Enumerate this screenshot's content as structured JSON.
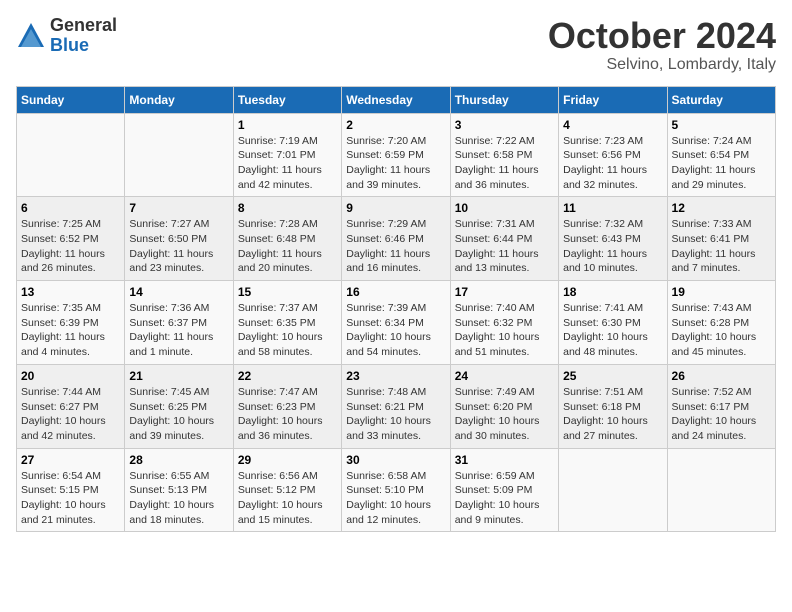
{
  "header": {
    "logo_general": "General",
    "logo_blue": "Blue",
    "month_title": "October 2024",
    "location": "Selvino, Lombardy, Italy"
  },
  "weekdays": [
    "Sunday",
    "Monday",
    "Tuesday",
    "Wednesday",
    "Thursday",
    "Friday",
    "Saturday"
  ],
  "weeks": [
    [
      {
        "day": "",
        "info": ""
      },
      {
        "day": "",
        "info": ""
      },
      {
        "day": "1",
        "info": "Sunrise: 7:19 AM\nSunset: 7:01 PM\nDaylight: 11 hours and 42 minutes."
      },
      {
        "day": "2",
        "info": "Sunrise: 7:20 AM\nSunset: 6:59 PM\nDaylight: 11 hours and 39 minutes."
      },
      {
        "day": "3",
        "info": "Sunrise: 7:22 AM\nSunset: 6:58 PM\nDaylight: 11 hours and 36 minutes."
      },
      {
        "day": "4",
        "info": "Sunrise: 7:23 AM\nSunset: 6:56 PM\nDaylight: 11 hours and 32 minutes."
      },
      {
        "day": "5",
        "info": "Sunrise: 7:24 AM\nSunset: 6:54 PM\nDaylight: 11 hours and 29 minutes."
      }
    ],
    [
      {
        "day": "6",
        "info": "Sunrise: 7:25 AM\nSunset: 6:52 PM\nDaylight: 11 hours and 26 minutes."
      },
      {
        "day": "7",
        "info": "Sunrise: 7:27 AM\nSunset: 6:50 PM\nDaylight: 11 hours and 23 minutes."
      },
      {
        "day": "8",
        "info": "Sunrise: 7:28 AM\nSunset: 6:48 PM\nDaylight: 11 hours and 20 minutes."
      },
      {
        "day": "9",
        "info": "Sunrise: 7:29 AM\nSunset: 6:46 PM\nDaylight: 11 hours and 16 minutes."
      },
      {
        "day": "10",
        "info": "Sunrise: 7:31 AM\nSunset: 6:44 PM\nDaylight: 11 hours and 13 minutes."
      },
      {
        "day": "11",
        "info": "Sunrise: 7:32 AM\nSunset: 6:43 PM\nDaylight: 11 hours and 10 minutes."
      },
      {
        "day": "12",
        "info": "Sunrise: 7:33 AM\nSunset: 6:41 PM\nDaylight: 11 hours and 7 minutes."
      }
    ],
    [
      {
        "day": "13",
        "info": "Sunrise: 7:35 AM\nSunset: 6:39 PM\nDaylight: 11 hours and 4 minutes."
      },
      {
        "day": "14",
        "info": "Sunrise: 7:36 AM\nSunset: 6:37 PM\nDaylight: 11 hours and 1 minute."
      },
      {
        "day": "15",
        "info": "Sunrise: 7:37 AM\nSunset: 6:35 PM\nDaylight: 10 hours and 58 minutes."
      },
      {
        "day": "16",
        "info": "Sunrise: 7:39 AM\nSunset: 6:34 PM\nDaylight: 10 hours and 54 minutes."
      },
      {
        "day": "17",
        "info": "Sunrise: 7:40 AM\nSunset: 6:32 PM\nDaylight: 10 hours and 51 minutes."
      },
      {
        "day": "18",
        "info": "Sunrise: 7:41 AM\nSunset: 6:30 PM\nDaylight: 10 hours and 48 minutes."
      },
      {
        "day": "19",
        "info": "Sunrise: 7:43 AM\nSunset: 6:28 PM\nDaylight: 10 hours and 45 minutes."
      }
    ],
    [
      {
        "day": "20",
        "info": "Sunrise: 7:44 AM\nSunset: 6:27 PM\nDaylight: 10 hours and 42 minutes."
      },
      {
        "day": "21",
        "info": "Sunrise: 7:45 AM\nSunset: 6:25 PM\nDaylight: 10 hours and 39 minutes."
      },
      {
        "day": "22",
        "info": "Sunrise: 7:47 AM\nSunset: 6:23 PM\nDaylight: 10 hours and 36 minutes."
      },
      {
        "day": "23",
        "info": "Sunrise: 7:48 AM\nSunset: 6:21 PM\nDaylight: 10 hours and 33 minutes."
      },
      {
        "day": "24",
        "info": "Sunrise: 7:49 AM\nSunset: 6:20 PM\nDaylight: 10 hours and 30 minutes."
      },
      {
        "day": "25",
        "info": "Sunrise: 7:51 AM\nSunset: 6:18 PM\nDaylight: 10 hours and 27 minutes."
      },
      {
        "day": "26",
        "info": "Sunrise: 7:52 AM\nSunset: 6:17 PM\nDaylight: 10 hours and 24 minutes."
      }
    ],
    [
      {
        "day": "27",
        "info": "Sunrise: 6:54 AM\nSunset: 5:15 PM\nDaylight: 10 hours and 21 minutes."
      },
      {
        "day": "28",
        "info": "Sunrise: 6:55 AM\nSunset: 5:13 PM\nDaylight: 10 hours and 18 minutes."
      },
      {
        "day": "29",
        "info": "Sunrise: 6:56 AM\nSunset: 5:12 PM\nDaylight: 10 hours and 15 minutes."
      },
      {
        "day": "30",
        "info": "Sunrise: 6:58 AM\nSunset: 5:10 PM\nDaylight: 10 hours and 12 minutes."
      },
      {
        "day": "31",
        "info": "Sunrise: 6:59 AM\nSunset: 5:09 PM\nDaylight: 10 hours and 9 minutes."
      },
      {
        "day": "",
        "info": ""
      },
      {
        "day": "",
        "info": ""
      }
    ]
  ]
}
